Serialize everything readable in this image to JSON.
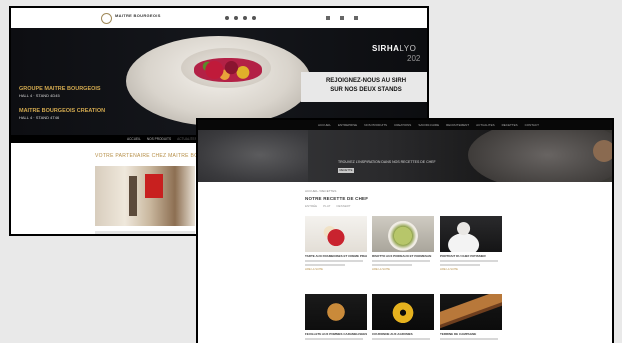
{
  "back_page": {
    "brand": "MAITRE BOURGEOIS",
    "brand_sub": "",
    "events": [
      {
        "title": "GROUPE MAITRE BOURGEOIS",
        "sub": "HALL 4 · STAND 4D45"
      },
      {
        "title": "MAITRE BOURGEOIS CREATION",
        "sub": "HALL 4 · STAND 4T46"
      }
    ],
    "sirha_bold": "SIRHA",
    "sirha_thin": "LYO",
    "sirha_year": "202",
    "join_line1": "REJOIGNEZ-NOUS AU SIRH",
    "join_line2": "SUR NOS DEUX STANDS",
    "nav": [
      "ACCUEIL",
      "NOS PRODUITS",
      "ACTUALITES",
      "",
      "",
      ""
    ],
    "section_heading": "VOTRE PARTENAIRE CHEZ MAITRE BOURGEOIS"
  },
  "front_page": {
    "nav": [
      "ACCUEIL",
      "ENTREPRISE",
      "NOS PRODUITS",
      "CREATIONS",
      "SAVOIR-FAIRE",
      "RECRUTEMENT",
      "ACTUALITES",
      "RECETTES",
      "CONTACT"
    ],
    "hero_text": "TROUVEZ L'INSPIRATION DANS NOS RECETTES DE CHEF",
    "hero_button": "RECETTE",
    "breadcrumb": "ACCUEIL / RECETTES",
    "title": "NOTRE RECETTE DE CHEF",
    "tabs": [
      "ENTRÉE",
      "PLAT",
      "DESSERT"
    ],
    "more_label": "LIRE LA SUITE",
    "cards": [
      {
        "caption": "TARTE AUX FRAMBOISES ET CREME PRALINEE"
      },
      {
        "caption": "RISOTTO AUX POIREAUX ET PARMESAN"
      },
      {
        "caption": "PORTRAIT DU CHEF PATISSIER"
      },
      {
        "caption": "FEUILLETE AUX POMMES CARAMELISEES"
      },
      {
        "caption": "COURONNE AUX AGRUMES"
      },
      {
        "caption": "TERRINE DE CAMPAGNE"
      }
    ]
  }
}
